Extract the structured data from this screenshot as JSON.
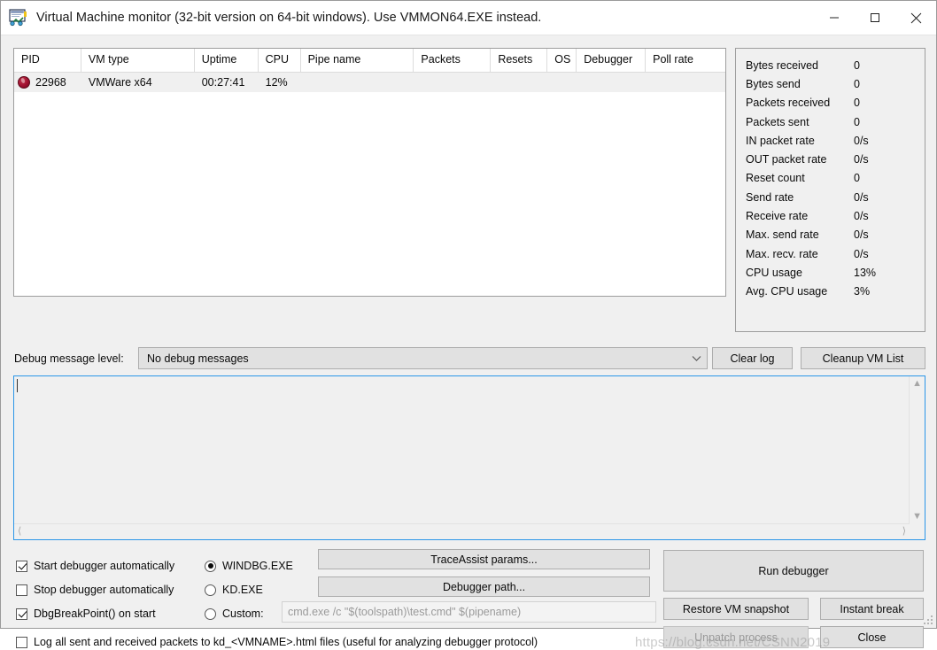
{
  "window": {
    "title": "Virtual Machine monitor (32-bit version on 64-bit windows). Use VMMON64.EXE instead.",
    "app_icon": "vm-monitor-icon",
    "minimize_label": "—",
    "maximize_label": "□",
    "close_label": "✕"
  },
  "vm_list": {
    "columns": [
      "PID",
      "VM type",
      "Uptime",
      "CPU",
      "Pipe name",
      "Packets",
      "Resets",
      "OS",
      "Debugger",
      "Poll rate"
    ],
    "rows": [
      {
        "status_icon": "vm-running-icon",
        "pid": "22968",
        "vm_type": "VMWare x64",
        "uptime": "00:27:41",
        "cpu": "12%",
        "pipe_name": "",
        "packets": "",
        "resets": "",
        "os": "",
        "debugger": "",
        "poll_rate": ""
      }
    ]
  },
  "stats": [
    {
      "label": "Bytes received",
      "value": "0"
    },
    {
      "label": "Bytes send",
      "value": "0"
    },
    {
      "label": "Packets received",
      "value": "0"
    },
    {
      "label": "Packets sent",
      "value": "0"
    },
    {
      "label": "IN packet rate",
      "value": "0/s"
    },
    {
      "label": "OUT packet rate",
      "value": "0/s"
    },
    {
      "label": "Reset count",
      "value": "0"
    },
    {
      "label": "Send rate",
      "value": "0/s"
    },
    {
      "label": "Receive rate",
      "value": "0/s"
    },
    {
      "label": "Max. send rate",
      "value": "0/s"
    },
    {
      "label": "Max. recv. rate",
      "value": "0/s"
    },
    {
      "label": "CPU usage",
      "value": "13%"
    },
    {
      "label": "Avg. CPU usage",
      "value": "3%"
    }
  ],
  "debug_level": {
    "label": "Debug message level:",
    "selected": "No debug messages"
  },
  "buttons": {
    "clear_log": "Clear log",
    "cleanup_vm_list": "Cleanup VM List",
    "trace_assist": "TraceAssist params...",
    "debugger_path": "Debugger path...",
    "run_debugger": "Run debugger",
    "restore_snapshot": "Restore VM snapshot",
    "instant_break": "Instant break",
    "unpatch_process": "Unpatch process",
    "close": "Close"
  },
  "log": {
    "value": ""
  },
  "checkboxes": [
    {
      "label": "Start debugger automatically",
      "checked": true
    },
    {
      "label": "Stop debugger automatically",
      "checked": false
    },
    {
      "label": "DbgBreakPoint() on start",
      "checked": true
    },
    {
      "label": "Log all sent and received packets to kd_<VMNAME>.html files (useful for analyzing debugger protocol)",
      "checked": false
    }
  ],
  "debugger_choice": {
    "options": [
      {
        "label": "WINDBG.EXE",
        "selected": true
      },
      {
        "label": "KD.EXE",
        "selected": false
      },
      {
        "label": "Custom:",
        "selected": false
      }
    ],
    "custom_command": "cmd.exe /c \"$(toolspath)\\test.cmd\" $(pipename)"
  },
  "watermark": "https://blog.csdn.net/CSNN2019",
  "colors": {
    "focus_border": "#2b96e8",
    "window_bg": "#f0f0f0",
    "button_bg": "#e1e1e1",
    "status_dot": "#a01030"
  }
}
